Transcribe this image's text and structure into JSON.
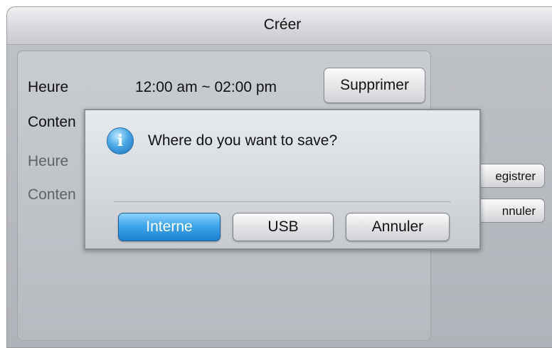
{
  "window": {
    "title": "Créer"
  },
  "form": {
    "row1_label": "Heure",
    "row1_value": "12:00 am ~ 02:00 pm",
    "delete_label": "Supprimer",
    "row2_label": "Conten",
    "row3_label": "Heure",
    "row4_label": "Conten"
  },
  "side": {
    "save_label": "egistrer",
    "cancel_label": "nnuler"
  },
  "dialog": {
    "icon": "info-icon",
    "icon_glyph": "i",
    "message": "Where do you want to save?",
    "buttons": [
      {
        "label": "Interne",
        "selected": true
      },
      {
        "label": "USB",
        "selected": false
      },
      {
        "label": "Annuler",
        "selected": false
      }
    ]
  },
  "colors": {
    "selected_button": "#3fa6ea",
    "panel_background": "#b7bac0"
  }
}
